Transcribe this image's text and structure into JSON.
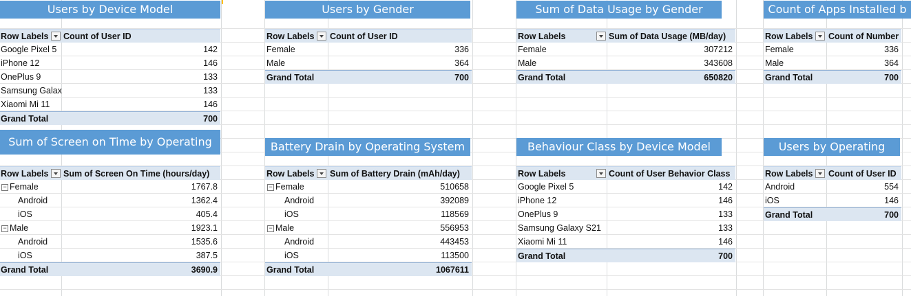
{
  "pivots": {
    "device": {
      "title": "Users by Device Model",
      "row_labels": "Row Labels",
      "value_header": "Count of User ID",
      "rows": [
        {
          "label": "Google Pixel 5",
          "value": "142"
        },
        {
          "label": "iPhone 12",
          "value": "146"
        },
        {
          "label": "OnePlus 9",
          "value": "133"
        },
        {
          "label": "Samsung Galax",
          "value": "133"
        },
        {
          "label": "Xiaomi Mi 11",
          "value": "146"
        }
      ],
      "total_label": "Grand Total",
      "total_value": "700"
    },
    "gender": {
      "title": "Users by Gender",
      "row_labels": "Row Labels",
      "value_header": "Count of User ID",
      "rows": [
        {
          "label": "Female",
          "value": "336"
        },
        {
          "label": "Male",
          "value": "364"
        }
      ],
      "total_label": "Grand Total",
      "total_value": "700"
    },
    "data_usage": {
      "title": "Sum of Data Usage by Gender",
      "row_labels": "Row Labels",
      "value_header": "Sum of Data Usage (MB/day)",
      "rows": [
        {
          "label": "Female",
          "value": "307212"
        },
        {
          "label": "Male",
          "value": "343608"
        }
      ],
      "total_label": "Grand Total",
      "total_value": "650820"
    },
    "apps": {
      "title": "Count of Apps Installed b",
      "row_labels": "Row Labels",
      "value_header": "Count of Number o",
      "rows": [
        {
          "label": "Female",
          "value": "336"
        },
        {
          "label": "Male",
          "value": "364"
        }
      ],
      "total_label": "Grand Total",
      "total_value": "700"
    },
    "screen_time": {
      "title": "Sum of Screen on Time by Operating",
      "row_labels": "Row Labels",
      "value_header": "Sum of Screen On Time (hours/day)",
      "rows": [
        {
          "label": "Female",
          "value": "1767.8",
          "group": true
        },
        {
          "label": "Android",
          "value": "1362.4"
        },
        {
          "label": "iOS",
          "value": "405.4"
        },
        {
          "label": "Male",
          "value": "1923.1",
          "group": true
        },
        {
          "label": "Android",
          "value": "1535.6"
        },
        {
          "label": "iOS",
          "value": "387.5"
        }
      ],
      "total_label": "Grand Total",
      "total_value": "3690.9"
    },
    "battery": {
      "title": "Battery Drain by Operating System",
      "row_labels": "Row Labels",
      "value_header": "Sum of Battery Drain (mAh/day)",
      "rows": [
        {
          "label": "Female",
          "value": "510658",
          "group": true
        },
        {
          "label": "Android",
          "value": "392089"
        },
        {
          "label": "iOS",
          "value": "118569"
        },
        {
          "label": "Male",
          "value": "556953",
          "group": true
        },
        {
          "label": "Android",
          "value": "443453"
        },
        {
          "label": "iOS",
          "value": "113500"
        }
      ],
      "total_label": "Grand Total",
      "total_value": "1067611"
    },
    "behaviour": {
      "title": "Behaviour Class by Device Model",
      "row_labels": "Row Labels",
      "value_header": "Count of User Behavior Class",
      "rows": [
        {
          "label": "Google Pixel 5",
          "value": "142"
        },
        {
          "label": "iPhone 12",
          "value": "146"
        },
        {
          "label": "OnePlus 9",
          "value": "133"
        },
        {
          "label": "Samsung Galaxy S21",
          "value": "133"
        },
        {
          "label": "Xiaomi Mi 11",
          "value": "146"
        }
      ],
      "total_label": "Grand Total",
      "total_value": "700"
    },
    "os_users": {
      "title": "Users by Operating",
      "row_labels": "Row Labels",
      "value_header": "Count of User ID",
      "rows": [
        {
          "label": "Android",
          "value": "554"
        },
        {
          "label": "iOS",
          "value": "146"
        }
      ],
      "total_label": "Grand Total",
      "total_value": "700"
    }
  },
  "colors": {
    "title_bar": "#5b9bd5",
    "header_row": "#dce6f1",
    "gridline": "#dadcdd"
  }
}
